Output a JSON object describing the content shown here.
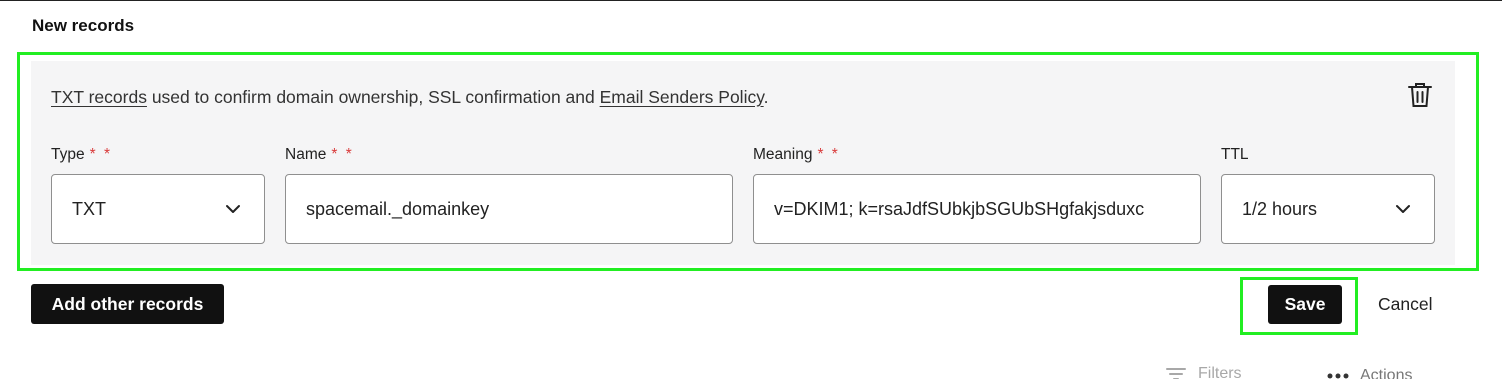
{
  "section": {
    "title": "New records"
  },
  "record": {
    "description": {
      "link1": "TXT records",
      "middle": " used to confirm domain ownership, SSL confirmation and ",
      "link2": "Email Senders Policy",
      "end": "."
    },
    "fields": {
      "type": {
        "label": "Type",
        "required_marker": "* *",
        "value": "TXT"
      },
      "name": {
        "label": "Name",
        "required_marker": "* *",
        "value": "spacemail._domainkey"
      },
      "meaning": {
        "label": "Meaning",
        "required_marker": "* *",
        "value": "v=DKIM1; k=rsaJdfSUbkjbSGUbSHgfakjsduxc"
      },
      "ttl": {
        "label": "TTL",
        "value": "1/2 hours"
      }
    }
  },
  "buttons": {
    "add_other": "Add other records",
    "save": "Save",
    "cancel": "Cancel"
  },
  "toolbar": {
    "filters": "Filters",
    "actions": "Actions"
  },
  "colors": {
    "highlight": "#22ee22",
    "required": "#d93a3a",
    "button_dark": "#111111"
  },
  "icons": [
    "trash-icon",
    "chevron-down-icon",
    "filter-icon",
    "more-dots-icon"
  ]
}
